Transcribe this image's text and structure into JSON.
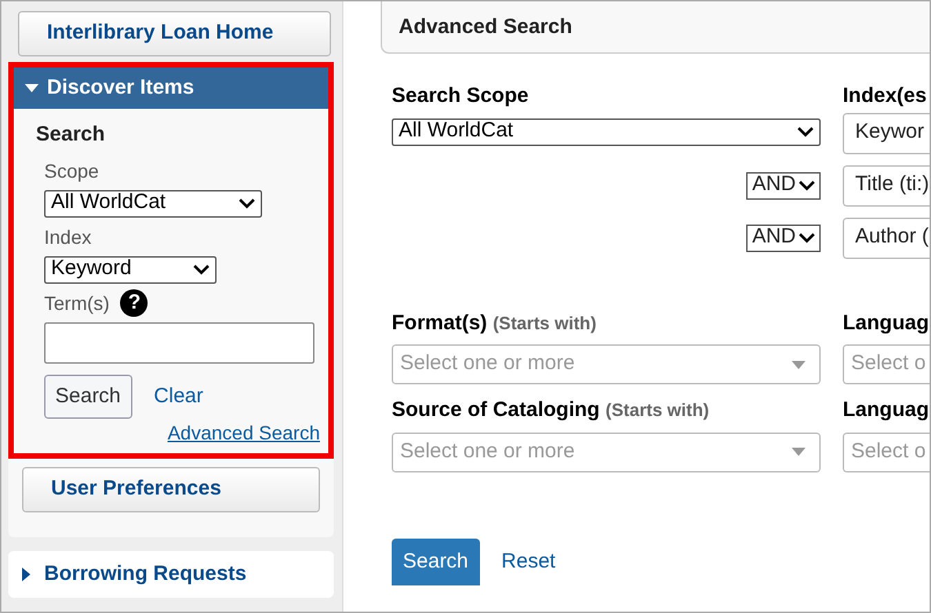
{
  "sidebar": {
    "home_button": "Interlibrary Loan Home",
    "discover": {
      "title": "Discover Items",
      "expanded": true,
      "highlighted": true,
      "heading": "Search",
      "scope_label": "Scope",
      "scope_value": "All WorldCat",
      "index_label": "Index",
      "index_value": "Keyword",
      "terms_label": "Term(s)",
      "help_icon": "?",
      "search_button": "Search",
      "clear_link": "Clear",
      "advanced_link": "Advanced Search"
    },
    "preferences_button": "User Preferences",
    "sections": [
      {
        "title": "Borrowing Requests",
        "expanded": false
      }
    ]
  },
  "main": {
    "title": "Advanced Search",
    "scope": {
      "label": "Search Scope",
      "value": "All WorldCat"
    },
    "index": {
      "label": "Index(es",
      "rows": [
        {
          "operator": "",
          "value": "Keywor"
        },
        {
          "operator": "AND",
          "value": "Title (ti:)"
        },
        {
          "operator": "AND",
          "value": "Author ("
        }
      ]
    },
    "filters": [
      {
        "label": "Format(s)",
        "hint": "(Starts with)",
        "placeholder": "Select one or more",
        "right_label": "Languag",
        "right_placeholder": "Select o"
      },
      {
        "label": "Source of Cataloging",
        "hint": "(Starts with)",
        "placeholder": "Select one or more",
        "right_label": "Languag",
        "right_placeholder": "Select o"
      }
    ],
    "search_button": "Search",
    "reset_link": "Reset"
  }
}
